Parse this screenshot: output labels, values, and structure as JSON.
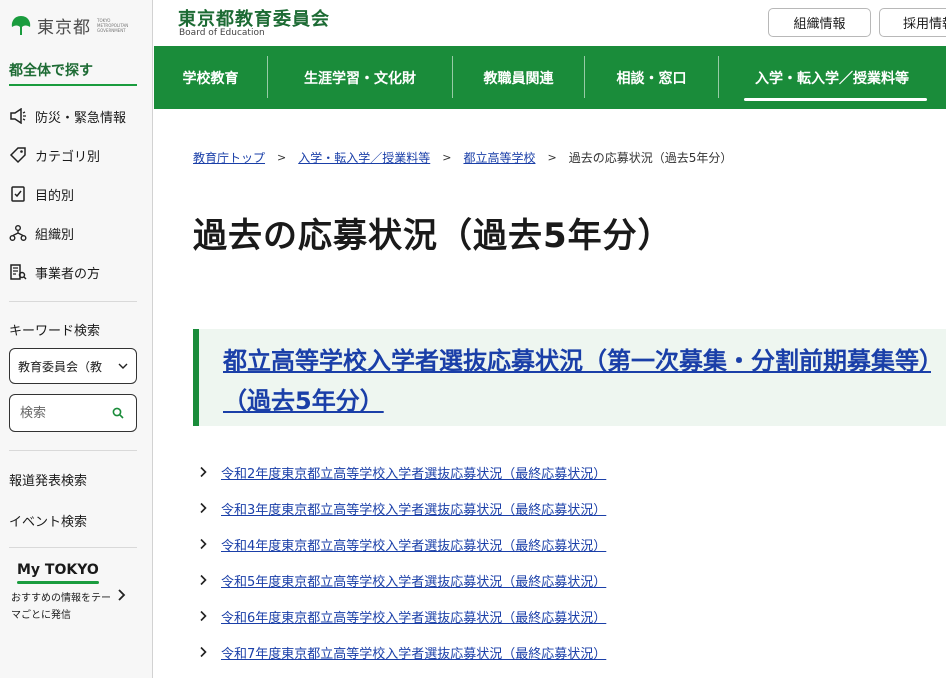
{
  "sidebar": {
    "logo_text": "東京都",
    "logo_sub": "TOKYO METROPOLITAN GOVERNMENT",
    "section_title": "都全体で探す",
    "items": [
      {
        "label": "防災・緊急情報",
        "icon": "megaphone-icon"
      },
      {
        "label": "カテゴリ別",
        "icon": "tag-icon"
      },
      {
        "label": "目的別",
        "icon": "checklist-icon"
      },
      {
        "label": "組織別",
        "icon": "org-chart-icon"
      },
      {
        "label": "事業者の方",
        "icon": "business-doc-icon"
      }
    ],
    "keyword_label": "キーワード検索",
    "select_value": "教育委員会（教",
    "search_placeholder": "検索",
    "press_search": "報道発表検索",
    "event_search": "イベント検索",
    "mytokyo_logo": "My TOKYO",
    "mytokyo_desc": "おすすめの情報をテーマごとに発信"
  },
  "header": {
    "title": "東京都教育委員会",
    "subtitle": "Board of Education",
    "buttons": [
      "組織情報",
      "採用情報"
    ]
  },
  "nav": {
    "items": [
      "学校教育",
      "生涯学習・文化財",
      "教職員関連",
      "相談・窓口",
      "入学・転入学／授業料等"
    ],
    "active_index": 4
  },
  "breadcrumb": {
    "links": [
      "教育庁トップ",
      "入学・転入学／授業料等",
      "都立高等学校"
    ],
    "current": "過去の応募状況（過去5年分）"
  },
  "main": {
    "title": "過去の応募状況（過去5年分）",
    "callout_link": "都立高等学校入学者選抜応募状況（第一次募集・分割前期募集等）（過去5年分）",
    "links": [
      "令和2年度東京都立高等学校入学者選抜応募状況（最終応募状況）",
      "令和3年度東京都立高等学校入学者選抜応募状況（最終応募状況）",
      "令和4年度東京都立高等学校入学者選抜応募状況（最終応募状況）",
      "令和5年度東京都立高等学校入学者選抜応募状況（最終応募状況）",
      "令和6年度東京都立高等学校入学者選抜応募状況（最終応募状況）",
      "令和7年度東京都立高等学校入学者選抜応募状況（最終応募状況）"
    ]
  },
  "colors": {
    "brand_green": "#1a8c3a",
    "link_blue": "#1a3fa8"
  }
}
